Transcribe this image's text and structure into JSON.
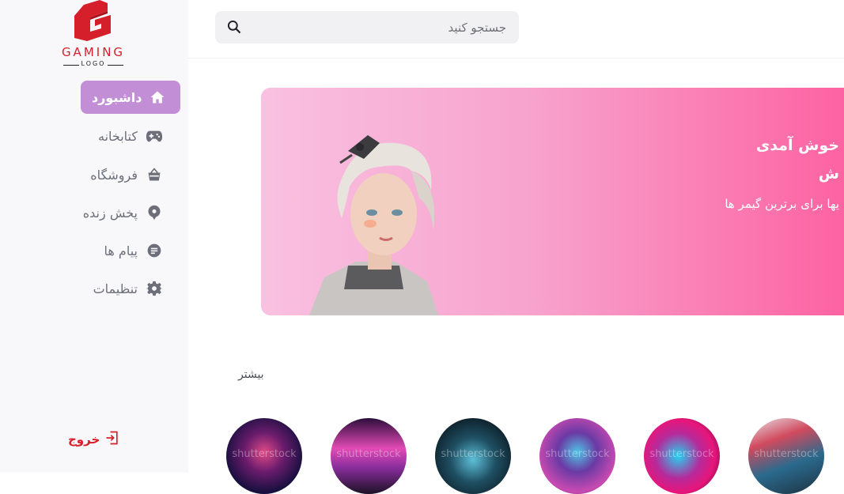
{
  "logo": {
    "word": "GAMING",
    "sub": "LOGO"
  },
  "sidebar": {
    "items": [
      {
        "label": "داشبورد",
        "icon": "home-icon",
        "active": true
      },
      {
        "label": "کتابخانه",
        "icon": "gamepad-icon",
        "active": false
      },
      {
        "label": "فروشگاه",
        "icon": "basket-icon",
        "active": false
      },
      {
        "label": "پخش زنده",
        "icon": "live-stream-icon",
        "active": false
      },
      {
        "label": "پیام ها",
        "icon": "message-icon",
        "active": false
      },
      {
        "label": "تنظیمات",
        "icon": "gear-icon",
        "active": false
      }
    ],
    "logout_label": "خروج"
  },
  "search": {
    "placeholder": "جستجو کنید"
  },
  "banner": {
    "title": "خوش آمدی",
    "title2": "ش",
    "subtitle": "یها برای برترین گیمر ها"
  },
  "streamers": {
    "more_label": "بیشتر",
    "watermark": "shutterstock"
  },
  "colors": {
    "accent": "#c28fd6",
    "logout": "#d51f2a",
    "banner_start": "#f9c1e1",
    "banner_end": "#fd5f9f"
  }
}
